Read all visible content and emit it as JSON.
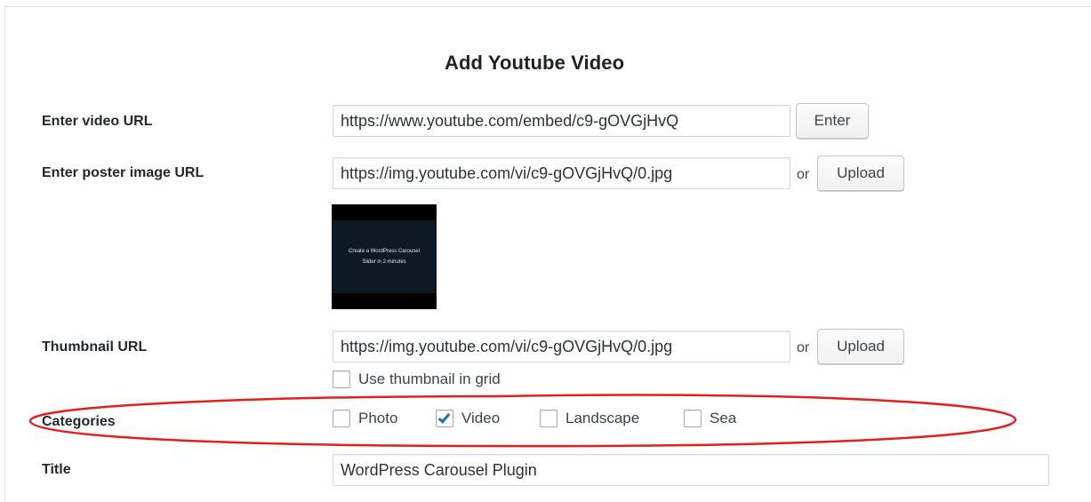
{
  "form": {
    "heading": "Add Youtube Video",
    "video_url": {
      "label": "Enter video URL",
      "value": "https://www.youtube.com/embed/c9-gOVGjHvQ",
      "button": "Enter"
    },
    "poster_url": {
      "label": "Enter poster image URL",
      "value": "https://img.youtube.com/vi/c9-gOVGjHvQ/0.jpg",
      "or": "or",
      "button": "Upload",
      "preview_text": [
        "Create a WordPress Carousel",
        "Slider in 2 minutes"
      ]
    },
    "thumbnail_url": {
      "label": "Thumbnail URL",
      "value": "https://img.youtube.com/vi/c9-gOVGjHvQ/0.jpg",
      "or": "or",
      "button": "Upload",
      "use_in_grid": {
        "label": "Use thumbnail in grid",
        "checked": false
      }
    },
    "categories": {
      "label": "Categories",
      "options": [
        {
          "label": "Photo",
          "checked": false
        },
        {
          "label": "Video",
          "checked": true
        },
        {
          "label": "Landscape",
          "checked": false
        },
        {
          "label": "Sea",
          "checked": false
        }
      ]
    },
    "title": {
      "label": "Title",
      "value": "WordPress Carousel Plugin"
    }
  },
  "colors": {
    "highlight": "#e0201f",
    "checkmark": "#2271b1"
  }
}
